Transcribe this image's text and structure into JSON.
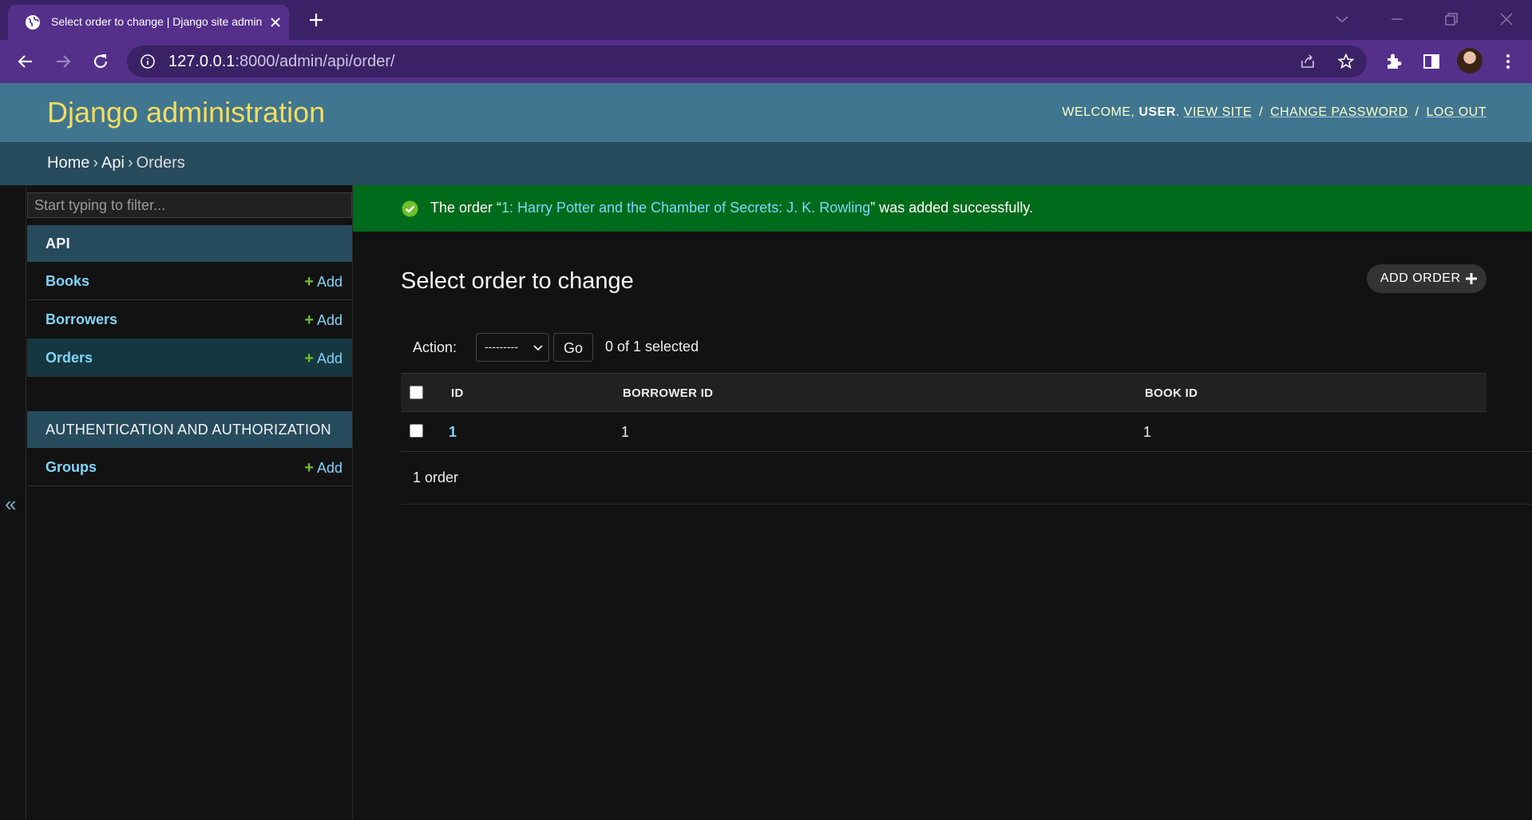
{
  "browser": {
    "tab_title": "Select order to change | Django site admin",
    "url_host": "127.0.0.1",
    "url_rest": ":8000/admin/api/order/"
  },
  "header": {
    "branding": "Django administration",
    "welcome": "Welcome,",
    "user": "user",
    "view_site": "View site",
    "change_password": "Change password",
    "log_out": "Log out"
  },
  "breadcrumbs": [
    "Home",
    "Api",
    "Orders"
  ],
  "sidebar": {
    "filter_placeholder": "Start typing to filter...",
    "collapse_glyph": "«",
    "modules": [
      {
        "caption": "API",
        "models": [
          {
            "name": "Books",
            "add": "Add"
          },
          {
            "name": "Borrowers",
            "add": "Add"
          },
          {
            "name": "Orders",
            "add": "Add",
            "current": true
          }
        ]
      },
      {
        "caption": "AUTHENTICATION AND AUTHORIZATION",
        "models": [
          {
            "name": "Groups",
            "add": "Add"
          }
        ]
      }
    ]
  },
  "message": {
    "prefix": "The order “",
    "link": "1: Harry Potter and the Chamber of Secrets: J. K. Rowling",
    "suffix": "” was added successfully."
  },
  "content": {
    "title": "Select order to change",
    "add_button": "ADD ORDER"
  },
  "actions": {
    "label": "Action:",
    "selected_value": "---------",
    "go": "Go",
    "counter": "0 of 1 selected"
  },
  "table": {
    "columns": [
      "ID",
      "BORROWER ID",
      "BOOK ID"
    ],
    "rows": [
      {
        "id": "1",
        "borrower_id": "1",
        "book_id": "1"
      }
    ]
  },
  "paginator": "1 order",
  "colors": {
    "header_bg": "#417690",
    "branding": "#f5dd5d",
    "breadcrumbs_bg": "#264b5d",
    "success_bg": "#006b1b",
    "link": "#81d4fa",
    "add_plus": "#70bf2b",
    "browser_frame": "#3b2266"
  }
}
